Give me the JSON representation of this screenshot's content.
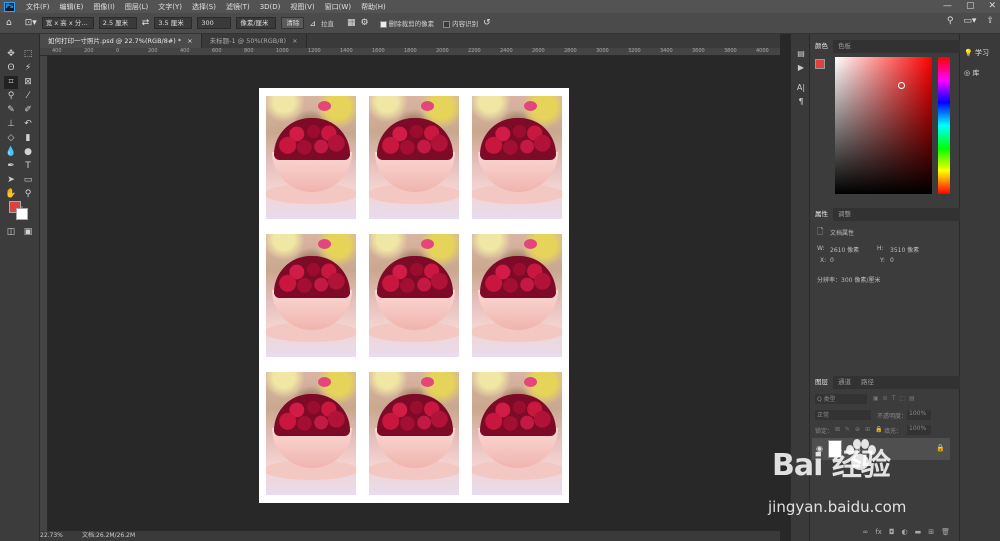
{
  "app": {
    "logo_text": "Ps"
  },
  "menu": [
    "文件(F)",
    "编辑(E)",
    "图像(I)",
    "图层(L)",
    "文字(Y)",
    "选择(S)",
    "滤镜(T)",
    "3D(D)",
    "视图(V)",
    "窗口(W)",
    "帮助(H)"
  ],
  "window_controls": {
    "minimize": "—",
    "maximize": "▢",
    "close": "✕"
  },
  "options": {
    "ratio_select": "宽 x 高 x 分...",
    "width_value": "2.5 厘米",
    "height_value": "3.5 厘米",
    "resolution_value": "300",
    "unit_select": "像素/厘米",
    "clear_button": "清除",
    "straighten_label": "拉直",
    "delete_cropped_label": "删除裁剪的像素",
    "content_aware_label": "内容识别",
    "delete_cropped_checked": true,
    "content_aware_checked": false
  },
  "tabs": [
    {
      "label": "如何打印一寸照片.psd @ 22.7%(RGB/8#) *",
      "close": "×"
    },
    {
      "label": "未标题-1 @ 50%(RGB/8)",
      "close": "×"
    }
  ],
  "ruler_ticks": [
    "400",
    "200",
    "0",
    "200",
    "400",
    "600",
    "800",
    "1000",
    "1200",
    "1400",
    "1600",
    "1800",
    "2000",
    "2200",
    "2400",
    "2600",
    "2800",
    "3000",
    "3200",
    "3400",
    "3600",
    "3800",
    "4000"
  ],
  "tools": [
    "move",
    "marquee",
    "lasso",
    "magic-wand",
    "crop",
    "frame",
    "eyedropper",
    "ruler",
    "spot-heal",
    "brush",
    "clone",
    "history",
    "eraser",
    "gradient",
    "blur",
    "dodge",
    "pen",
    "type",
    "path-select",
    "rectangle",
    "hand",
    "zoom",
    "more",
    "quick-mask",
    "screen-mode"
  ],
  "colors": {
    "foreground": "#d94343",
    "background": "#ffffff",
    "canvas": "#282828",
    "document": "#ffffff"
  },
  "color_panel": {
    "tabs": [
      "颜色",
      "色板"
    ]
  },
  "properties_panel": {
    "tabs": [
      "属性",
      "调整"
    ],
    "section_title": "文档属性",
    "w_label": "W:",
    "w_value": "2610 像素",
    "h_label": "H:",
    "h_value": "3510 像素",
    "x_label": "X:",
    "x_value": "0",
    "y_label": "Y:",
    "y_value": "0",
    "resolution": "分辨率：300 像素/厘米"
  },
  "layers_panel": {
    "tabs": [
      "图层",
      "通道",
      "路径"
    ],
    "filter_label": "Q 类型",
    "blend_mode": "正常",
    "opacity_label": "不透明度：",
    "opacity_value": "100%",
    "lock_label": "锁定：",
    "fill_label": "填充：",
    "fill_value": "100%",
    "layer_name": "背景"
  },
  "learn_panel": {
    "items": [
      "学习",
      "库"
    ]
  },
  "status": {
    "zoom": "22.73%",
    "doc": "文档:26.2M/26.2M"
  },
  "watermark": {
    "brand": "Bai  经验",
    "url": "jingyan.baidu.com"
  },
  "photos": 9
}
